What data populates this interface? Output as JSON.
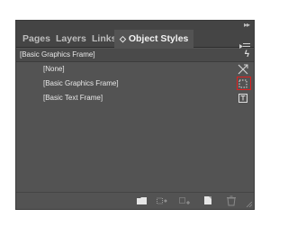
{
  "tabs": [
    {
      "label": "Pages",
      "active": false
    },
    {
      "label": "Layers",
      "active": false
    },
    {
      "label": "Links",
      "active": false
    },
    {
      "label": "Object Styles",
      "active": true
    }
  ],
  "header": {
    "default_style": "[Basic Graphics Frame]"
  },
  "styles": [
    {
      "label": "[None]",
      "icon": "none-style-icon"
    },
    {
      "label": "[Basic Graphics Frame]",
      "icon": "graphics-frame-icon",
      "highlighted": true
    },
    {
      "label": "[Basic Text Frame]",
      "icon": "text-frame-icon"
    }
  ],
  "colors": {
    "panel": "#535353",
    "highlight": "#e02020"
  }
}
